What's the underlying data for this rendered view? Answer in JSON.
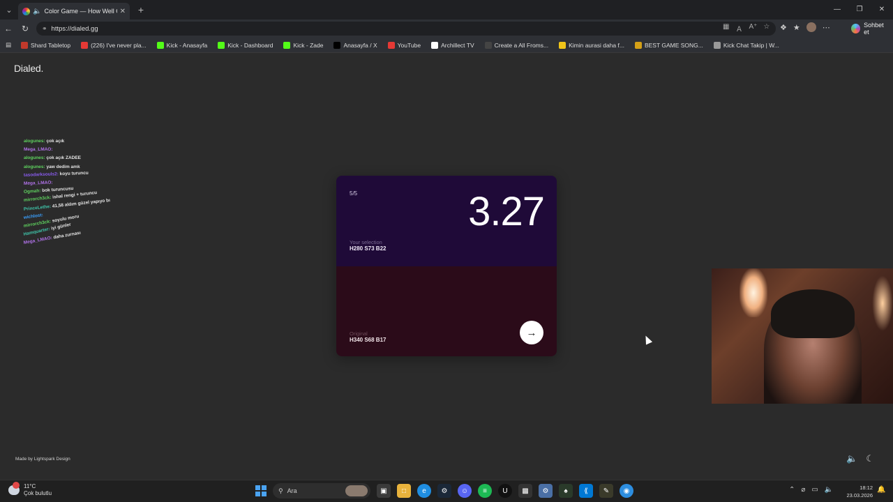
{
  "browser": {
    "tab_title": "Color Game — How Well Can",
    "new_tab": "+",
    "url": "https://dialed.gg",
    "copilot_label": "Sohbet et"
  },
  "bookmarks": [
    {
      "label": "Shard Tabletop",
      "color": "#c0392b"
    },
    {
      "label": "(226) I've never pla...",
      "color": "#e53935"
    },
    {
      "label": "Kick - Anasayfa",
      "color": "#53fc18"
    },
    {
      "label": "Kick - Dashboard",
      "color": "#53fc18"
    },
    {
      "label": "Kick - Zade",
      "color": "#53fc18"
    },
    {
      "label": "Anasayfa / X",
      "color": "#000000"
    },
    {
      "label": "YouTube",
      "color": "#e53935"
    },
    {
      "label": "Archillect TV",
      "color": "#ffffff"
    },
    {
      "label": "Create a All Froms...",
      "color": "#444444"
    },
    {
      "label": "Kimin aurasi daha f...",
      "color": "#f0c419"
    },
    {
      "label": "BEST GAME SONG...",
      "color": "#d4a017"
    },
    {
      "label": "Kick Chat Takip | W...",
      "color": "#999999"
    }
  ],
  "page": {
    "logo": "Dialed.",
    "made_by": "Made by Lightspark Design"
  },
  "chat": [
    {
      "user": "alogunes:",
      "msg": "çok açık",
      "cls": "u1"
    },
    {
      "user": "Mega_LMAO:",
      "msg": "",
      "cls": "u2"
    },
    {
      "user": "alogunes:",
      "msg": "çok açık ZADEE",
      "cls": "u1"
    },
    {
      "user": "alogunes:",
      "msg": "yaw dedim amk",
      "cls": "u1"
    },
    {
      "user": "tasodarksouls2:",
      "msg": "koyu turuncu",
      "cls": "u5"
    },
    {
      "user": "Mega_LMAO:",
      "msg": "",
      "cls": "u2"
    },
    {
      "user": "Ogmah:",
      "msg": "bok turuncusu",
      "cls": "u1"
    },
    {
      "user": "mirrorch3ck:",
      "msg": "ishal rengi + turuncu",
      "cls": "u1"
    },
    {
      "user": "PrinceLethe:",
      "msg": "41,58 aldım güzel yapıyo bı",
      "cls": "u3"
    },
    {
      "user": "wichlost:",
      "msg": "",
      "cls": "u4"
    },
    {
      "user": "mirrorch3ck:",
      "msg": "soyulu moru",
      "cls": "u1"
    },
    {
      "user": "Hamquarter:",
      "msg": "iyi günler",
      "cls": "u3"
    },
    {
      "user": "Mega_LMAO:",
      "msg": "daha zurnası",
      "cls": "u2"
    }
  ],
  "card": {
    "round": "5/5",
    "score": "3.27",
    "selection_label": "Your selection",
    "selection_value": "H280 S73 B22",
    "original_label": "Original",
    "original_value": "H340 S68 B17",
    "selection_color": "#1f0a38",
    "original_color": "#2b0b19"
  },
  "taskbar": {
    "temp": "11°C",
    "weather": "Çok bulutlu",
    "search": "Ara",
    "time": "18:12",
    "date": "23.03.2026"
  }
}
